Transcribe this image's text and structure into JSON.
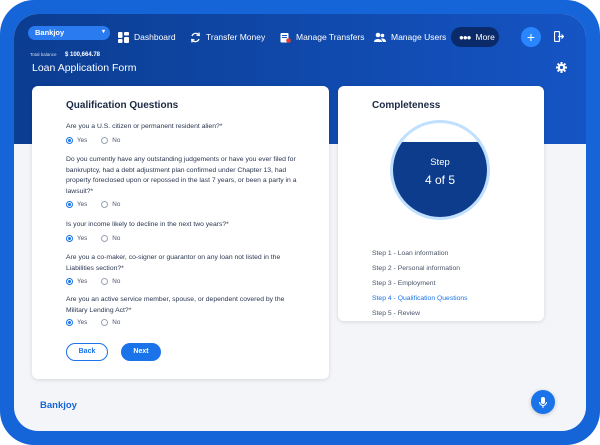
{
  "account": {
    "name": "Bankjoy",
    "balance_label": "Total balance",
    "balance_value": "$ 100,664.78"
  },
  "nav": {
    "dashboard": "Dashboard",
    "transfer_money": "Transfer Money",
    "manage_transfers": "Manage Transfers",
    "manage_users": "Manage Users",
    "more": "More"
  },
  "page": {
    "title": "Loan Application Form"
  },
  "qualification": {
    "title": "Qualification Questions",
    "questions": [
      {
        "text": "Are you a U.S. citizen or permanent resident alien?*",
        "selected": "Yes"
      },
      {
        "text": "Do you currently have any outstanding judgements or have you ever filed for bankruptcy, had a debt adjustment plan confirmed under Chapter 13, had property foreclosed upon or repossed in the last 7 years, or been a party in a lawsuit?*",
        "selected": "Yes"
      },
      {
        "text": "Is your income likely to decline in the next two years?*",
        "selected": "Yes"
      },
      {
        "text": "Are you a co-maker, co-signer or guarantor on any loan not listed in the Liabilities section?*",
        "selected": "Yes"
      },
      {
        "text": "Are you an active service member, spouse, or dependent covered by the Military Lending Act?*",
        "selected": "Yes"
      }
    ],
    "yes_label": "Yes",
    "no_label": "No",
    "back_label": "Back",
    "next_label": "Next"
  },
  "completeness": {
    "title": "Completeness",
    "step_label": "Step",
    "step_count": "4 of 5",
    "progress_fraction": 0.8,
    "steps": [
      "Step 1 - Loan information",
      "Step 2 - Personal information",
      "Step 3 - Employment",
      "Step 4 - Qualification Questions",
      "Step 5 - Review"
    ],
    "active_step_index": 3
  },
  "footer": {
    "brand": "Bankjoy"
  },
  "colors": {
    "primary": "#1565d8",
    "accent": "#1a73e8",
    "hero_dark": "#0b3d91",
    "ring_fill": "#0d3c8c"
  },
  "icons": [
    "dashboard-icon",
    "transfer-icon",
    "manage-transfers-icon",
    "users-icon",
    "more-dots-icon",
    "plus-icon",
    "logout-icon",
    "settings-icon",
    "microphone-icon"
  ]
}
